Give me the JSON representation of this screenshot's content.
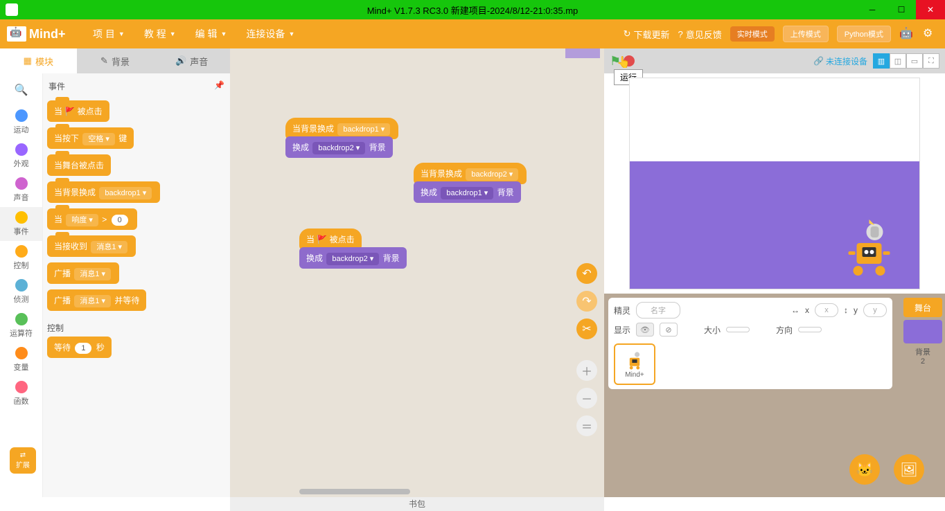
{
  "title": "Mind+ V1.7.3 RC3.0   新建项目-2024/8/12-21:0:35.mp",
  "menu": {
    "project": "项 目",
    "tutorial": "教 程",
    "edit": "编 辑",
    "device": "连接设备"
  },
  "topright": {
    "download": "下载更新",
    "feedback": "意见反馈",
    "modes": {
      "realtime": "实时模式",
      "upload": "上传模式",
      "python": "Python模式"
    }
  },
  "tabs": {
    "blocks": "模块",
    "backdrop": "背景",
    "sound": "声音"
  },
  "categories": {
    "motion": "运动",
    "looks": "外观",
    "sound": "声音",
    "events": "事件",
    "control": "控制",
    "sensing": "侦测",
    "operators": "运算符",
    "variables": "变量",
    "functions": "函数"
  },
  "palette": {
    "section": "事件",
    "section2": "控制",
    "whenFlag": {
      "p1": "当",
      "p3": "被点击"
    },
    "whenKey": {
      "p1": "当按下",
      "opt": "空格",
      "p3": "键"
    },
    "whenStage": "当舞台被点击",
    "whenBackdrop": {
      "p1": "当背景换成",
      "opt": "backdrop1"
    },
    "whenLoud": {
      "p1": "当",
      "opt": "响度",
      "gt": ">",
      "val": "0"
    },
    "whenMsg": {
      "p1": "当接收到",
      "opt": "消息1"
    },
    "broadcast": {
      "p1": "广播",
      "opt": "消息1"
    },
    "broadcastWait": {
      "p1": "广播",
      "opt": "消息1",
      "p3": "并等待"
    },
    "wait": {
      "p1": "等待",
      "val": "1",
      "p3": "秒"
    }
  },
  "workspace": {
    "b1": {
      "hat": "当背景换成",
      "hopt": "backdrop1",
      "stack": "换成",
      "sopt": "backdrop2",
      "suffix": "背景"
    },
    "b2": {
      "hat": "当背景换成",
      "hopt": "backdrop2",
      "stack": "换成",
      "sopt": "backdrop1",
      "suffix": "背景"
    },
    "b3": {
      "hat1": "当",
      "hat3": "被点击",
      "stack": "换成",
      "sopt": "backdrop2",
      "suffix": "背景"
    }
  },
  "stagehead": {
    "tooltip": "运行",
    "device": "未连接设备"
  },
  "sprite": {
    "label": "精灵",
    "namePh": "名字",
    "xlabel": "x",
    "xPh": "x",
    "ylabel": "y",
    "yPh": "y",
    "showLabel": "显示",
    "sizeLabel": "大小",
    "dirLabel": "方向",
    "card": "Mind+"
  },
  "stageSide": {
    "tab": "舞台",
    "thumbLabel": "背景",
    "thumbCount": "2"
  },
  "extension": "扩展",
  "backpack": "书包"
}
